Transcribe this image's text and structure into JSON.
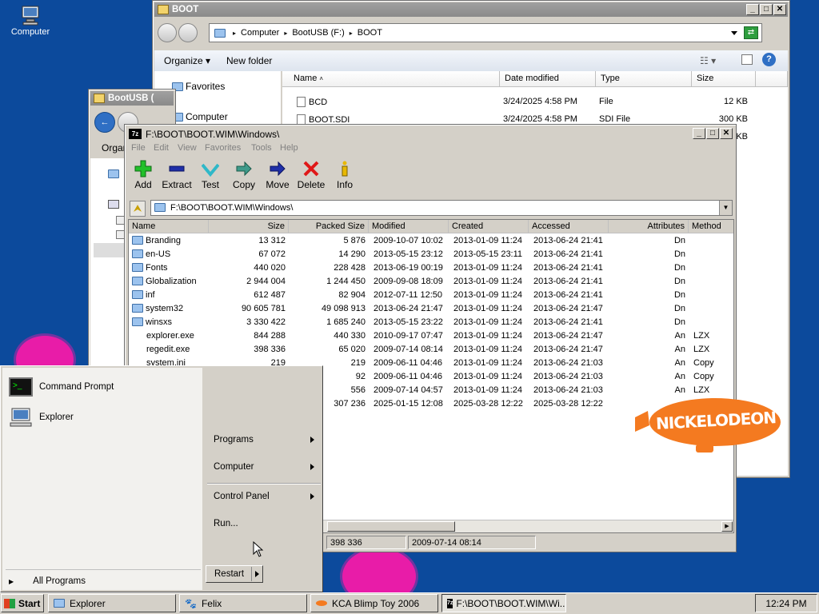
{
  "desktop": {
    "computer_label": "Computer"
  },
  "boot_window": {
    "title": "BOOT",
    "address": [
      "Computer",
      "BootUSB (F:)",
      "BOOT"
    ],
    "organize_label": "Organize",
    "new_folder_label": "New folder",
    "nav": {
      "favorites": "Favorites",
      "computer": "Computer"
    },
    "columns": [
      "Name",
      "Date modified",
      "Type",
      "Size"
    ],
    "files": [
      {
        "name": "BCD",
        "date": "3/24/2025 4:58 PM",
        "type": "File",
        "size": "12 KB"
      },
      {
        "name": "BOOT.SDI",
        "date": "3/24/2025 4:58 PM",
        "type": "SDI File",
        "size": "300 KB"
      },
      {
        "name": "",
        "date": "",
        "type": "",
        "size": "KB"
      }
    ]
  },
  "bootusb_window": {
    "title": "BootUSB (",
    "organize_label": "Organ"
  },
  "zip_window": {
    "title": "F:\\BOOT\\BOOT.WIM\\Windows\\",
    "menu": [
      "File",
      "Edit",
      "View",
      "Favorites",
      "Tools",
      "Help"
    ],
    "toolbar": [
      "Add",
      "Extract",
      "Test",
      "Copy",
      "Move",
      "Delete",
      "Info"
    ],
    "path": "F:\\BOOT\\BOOT.WIM\\Windows\\",
    "columns": [
      "Name",
      "Size",
      "Packed Size",
      "Modified",
      "Created",
      "Accessed",
      "Attributes",
      "Method"
    ],
    "rows": [
      {
        "name": "Branding",
        "folder": true,
        "size": "13 312",
        "packed": "5 876",
        "modified": "2009-10-07 10:02",
        "created": "2013-01-09 11:24",
        "accessed": "2013-06-24 21:41",
        "attr": "Dn",
        "method": ""
      },
      {
        "name": "en-US",
        "folder": true,
        "size": "67 072",
        "packed": "14 290",
        "modified": "2013-05-15 23:12",
        "created": "2013-05-15 23:11",
        "accessed": "2013-06-24 21:41",
        "attr": "Dn",
        "method": ""
      },
      {
        "name": "Fonts",
        "folder": true,
        "size": "440 020",
        "packed": "228 428",
        "modified": "2013-06-19 00:19",
        "created": "2013-01-09 11:24",
        "accessed": "2013-06-24 21:41",
        "attr": "Dn",
        "method": ""
      },
      {
        "name": "Globalization",
        "folder": true,
        "size": "2 944 004",
        "packed": "1 244 450",
        "modified": "2009-09-08 18:09",
        "created": "2013-01-09 11:24",
        "accessed": "2013-06-24 21:41",
        "attr": "Dn",
        "method": ""
      },
      {
        "name": "inf",
        "folder": true,
        "size": "612 487",
        "packed": "82 904",
        "modified": "2012-07-11 12:50",
        "created": "2013-01-09 11:24",
        "accessed": "2013-06-24 21:41",
        "attr": "Dn",
        "method": ""
      },
      {
        "name": "system32",
        "folder": true,
        "size": "90 605 781",
        "packed": "49 098 913",
        "modified": "2013-06-24 21:47",
        "created": "2013-01-09 11:24",
        "accessed": "2013-06-24 21:47",
        "attr": "Dn",
        "method": ""
      },
      {
        "name": "winsxs",
        "folder": true,
        "size": "3 330 422",
        "packed": "1 685 240",
        "modified": "2013-05-15 23:22",
        "created": "2013-01-09 11:24",
        "accessed": "2013-06-24 21:41",
        "attr": "Dn",
        "method": ""
      },
      {
        "name": "explorer.exe",
        "folder": false,
        "size": "844 288",
        "packed": "440 330",
        "modified": "2010-09-17 07:47",
        "created": "2013-01-09 11:24",
        "accessed": "2013-06-24 21:47",
        "attr": "An",
        "method": "LZX"
      },
      {
        "name": "regedit.exe",
        "folder": false,
        "size": "398 336",
        "packed": "65 020",
        "modified": "2009-07-14 08:14",
        "created": "2013-01-09 11:24",
        "accessed": "2013-06-24 21:47",
        "attr": "An",
        "method": "LZX"
      },
      {
        "name": "system.ini",
        "folder": false,
        "size": "219",
        "packed": "219",
        "modified": "2009-06-11 04:46",
        "created": "2013-01-09 11:24",
        "accessed": "2013-06-24 21:03",
        "attr": "An",
        "method": "Copy"
      },
      {
        "name": "",
        "folder": false,
        "size": "",
        "packed": "92",
        "modified": "2009-06-11 04:46",
        "created": "2013-01-09 11:24",
        "accessed": "2013-06-24 21:03",
        "attr": "An",
        "method": "Copy"
      },
      {
        "name": "",
        "folder": false,
        "size": "",
        "packed": "556",
        "modified": "2009-07-14 04:57",
        "created": "2013-01-09 11:24",
        "accessed": "2013-06-24 21:03",
        "attr": "An",
        "method": "LZX"
      },
      {
        "name": "",
        "folder": false,
        "size": "",
        "packed": "307 236",
        "modified": "2025-01-15 12:08",
        "created": "2025-03-28 12:22",
        "accessed": "2025-03-28 12:22",
        "attr": "",
        "method": ""
      }
    ],
    "status": [
      "398 336",
      "2009-07-14 08:14"
    ]
  },
  "start_menu": {
    "left_items": [
      "Command Prompt",
      "Explorer"
    ],
    "all_programs": "All Programs",
    "right_items": [
      "Programs",
      "Computer",
      "Control Panel",
      "Run..."
    ],
    "restart_label": "Restart"
  },
  "nick_logo": "NICKELODEON",
  "taskbar": {
    "start_label": "Start",
    "tasks": [
      "Explorer",
      "Felix",
      "KCA Blimp Toy 2006",
      "F:\\BOOT\\BOOT.WIM\\Wi..."
    ],
    "clock": "12:24 PM"
  },
  "colors": {
    "desktop": "#0c4a9c",
    "blob": "#e81ca8",
    "nick_orange": "#f47a20"
  }
}
